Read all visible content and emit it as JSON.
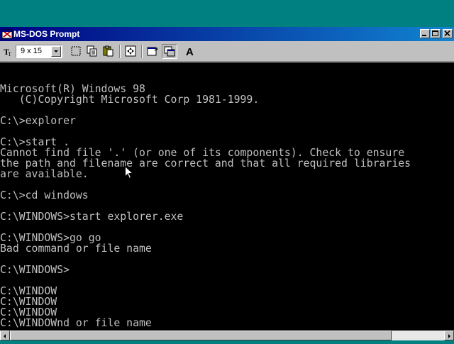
{
  "window": {
    "title": "MS-DOS Prompt",
    "icon": "msdos-app-icon"
  },
  "toolbar": {
    "font_size": "9 x 15",
    "tools": [
      "font-icon",
      "mark-icon",
      "copy-icon",
      "paste-icon",
      "fullscreen-icon",
      "properties-icon",
      "background-icon",
      "font-dialog-icon"
    ]
  },
  "console": {
    "lines": [
      "Microsoft(R) Windows 98",
      "   (C)Copyright Microsoft Corp 1981-1999.",
      "",
      "C:\\>explorer",
      "",
      "C:\\>start .",
      "Cannot find file '.' (or one of its components). Check to ensure",
      "the path and filename are correct and that all required libraries",
      "are available.",
      "",
      "C:\\>cd windows",
      "",
      "C:\\WINDOWS>start explorer.exe",
      "",
      "C:\\WINDOWS>go go",
      "Bad command or file name",
      "",
      "C:\\WINDOWS>",
      "",
      "C:\\WINDOW",
      "C:\\WINDOW",
      "C:\\WINDOW",
      "C:\\WINDOWnd or file name"
    ]
  },
  "colors": {
    "desktop": "#008080",
    "titlebar_start": "#000080",
    "titlebar_end": "#1084d0",
    "console_bg": "#000000",
    "console_text": "#c0c0c0"
  }
}
